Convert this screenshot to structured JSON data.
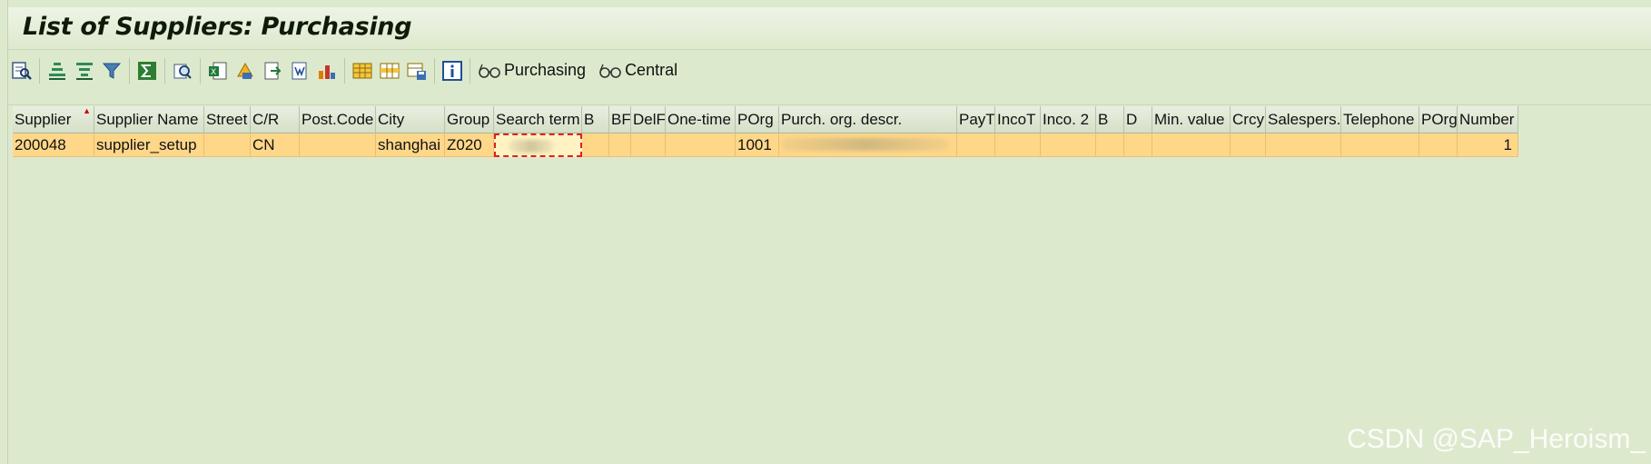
{
  "title": "List of Suppliers: Purchasing",
  "toolbar": {
    "icons": [
      "details-icon",
      "sort-ascending-icon",
      "sort-descending-icon",
      "filter-icon",
      "sum-icon",
      "print-preview-icon",
      "export-excel-icon",
      "abc-analysis-icon",
      "export-file-icon",
      "word-processing-icon",
      "graphic-icon",
      "change-layout-icon",
      "select-layout-icon",
      "save-layout-icon",
      "information-icon"
    ],
    "purchasing_label": "Purchasing",
    "central_label": "Central"
  },
  "table": {
    "columns": [
      "Supplier",
      "Supplier Name",
      "Street",
      "C/R",
      "Post.Code",
      "City",
      "Group",
      "Search term",
      "B",
      "BF",
      "DelF",
      "One-time",
      "POrg",
      "Purch. org. descr.",
      "PayT",
      "IncoT",
      "Inco. 2",
      "B",
      "D",
      "Min. value",
      "Crcy",
      "Salespers.",
      "Telephone",
      "POrg",
      "Number"
    ],
    "rows": [
      {
        "supplier": "200048",
        "name": "supplier_setup",
        "street": "",
        "country": "CN",
        "postcode": "",
        "city": "shanghai",
        "group": "Z020",
        "porg": "1001",
        "number": "1"
      }
    ]
  },
  "watermark": "CSDN @SAP_Heroism_",
  "colors": {
    "background": "#dde9cd",
    "selected_row": "#ffd789",
    "sort_marker": "#d00000",
    "focus_border": "#e02020"
  }
}
